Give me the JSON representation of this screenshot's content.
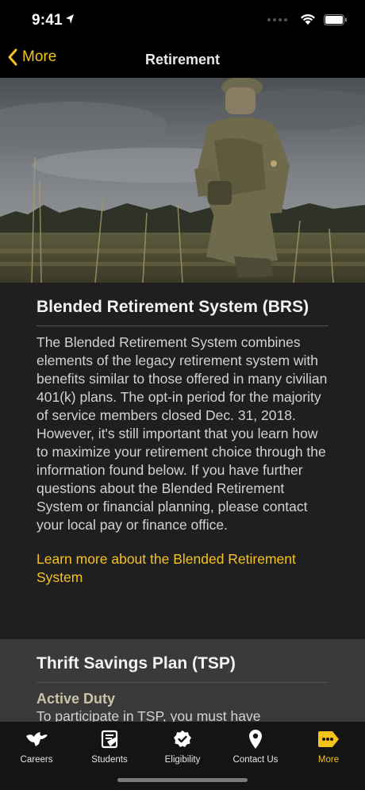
{
  "status_bar": {
    "time": "9:41"
  },
  "nav": {
    "back_label": "More",
    "title": "Retirement"
  },
  "brs": {
    "title": "Blended Retirement System (BRS)",
    "body": "The Blended Retirement System combines elements of the legacy retirement system with benefits similar to those offered in many civilian 401(k) plans. The opt-in period for the majority of service members closed Dec. 31, 2018. However, it's still important that you learn how to maximize your retirement choice through the information found below. If you have further questions about the Blended Retirement System or financial planning, please contact your local pay or finance office.",
    "link": "Learn more about the Blended Retirement System"
  },
  "tsp": {
    "title": "Thrift Savings Plan (TSP)",
    "subtitle": "Active Duty",
    "body": "To participate in TSP, you must have"
  },
  "tabs": [
    {
      "label": "Careers",
      "icon": "eagle-icon"
    },
    {
      "label": "Students",
      "icon": "graduation-icon"
    },
    {
      "label": "Eligibility",
      "icon": "check-badge-icon"
    },
    {
      "label": "Contact Us",
      "icon": "location-pin-icon"
    },
    {
      "label": "More",
      "icon": "more-tag-icon"
    }
  ],
  "colors": {
    "accent": "#f6c21c",
    "background": "#000000",
    "section_dark": "#1f1f1f",
    "section_mid": "#3a3a3a"
  }
}
